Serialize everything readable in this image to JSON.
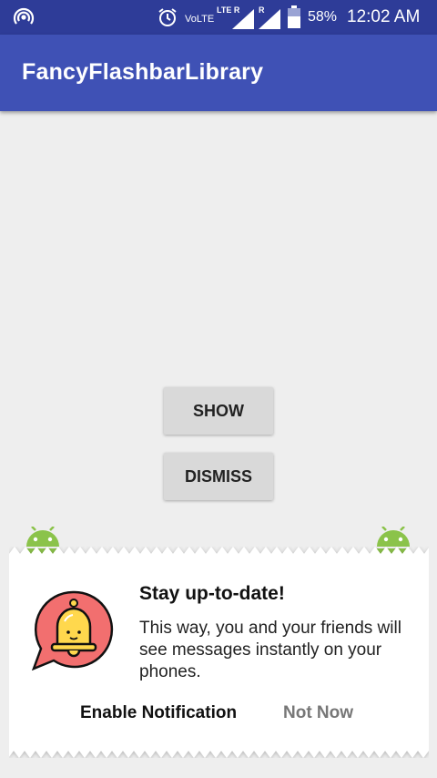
{
  "status_bar": {
    "network_type": "VoLTE",
    "lte_label": "LTE R",
    "roaming_label": "R",
    "battery_percent": "58%",
    "time": "12:02 AM"
  },
  "app_bar": {
    "title": "FancyFlashbarLibrary"
  },
  "buttons": {
    "show_label": "SHOW",
    "dismiss_label": "DISMISS"
  },
  "flashbar": {
    "title": "Stay up-to-date!",
    "message": "This way, you and your friends will see messages instantly on your phones.",
    "positive_action": "Enable Notification",
    "negative_action": "Not Now",
    "icon": "bell-icon"
  },
  "colors": {
    "status_bar": "#2e3c98",
    "app_bar": "#3f51b5",
    "background": "#eeeeee",
    "android_green": "#8bc34a",
    "bell_bubble": "#f26f6f",
    "bell_yellow": "#ffd84d"
  }
}
